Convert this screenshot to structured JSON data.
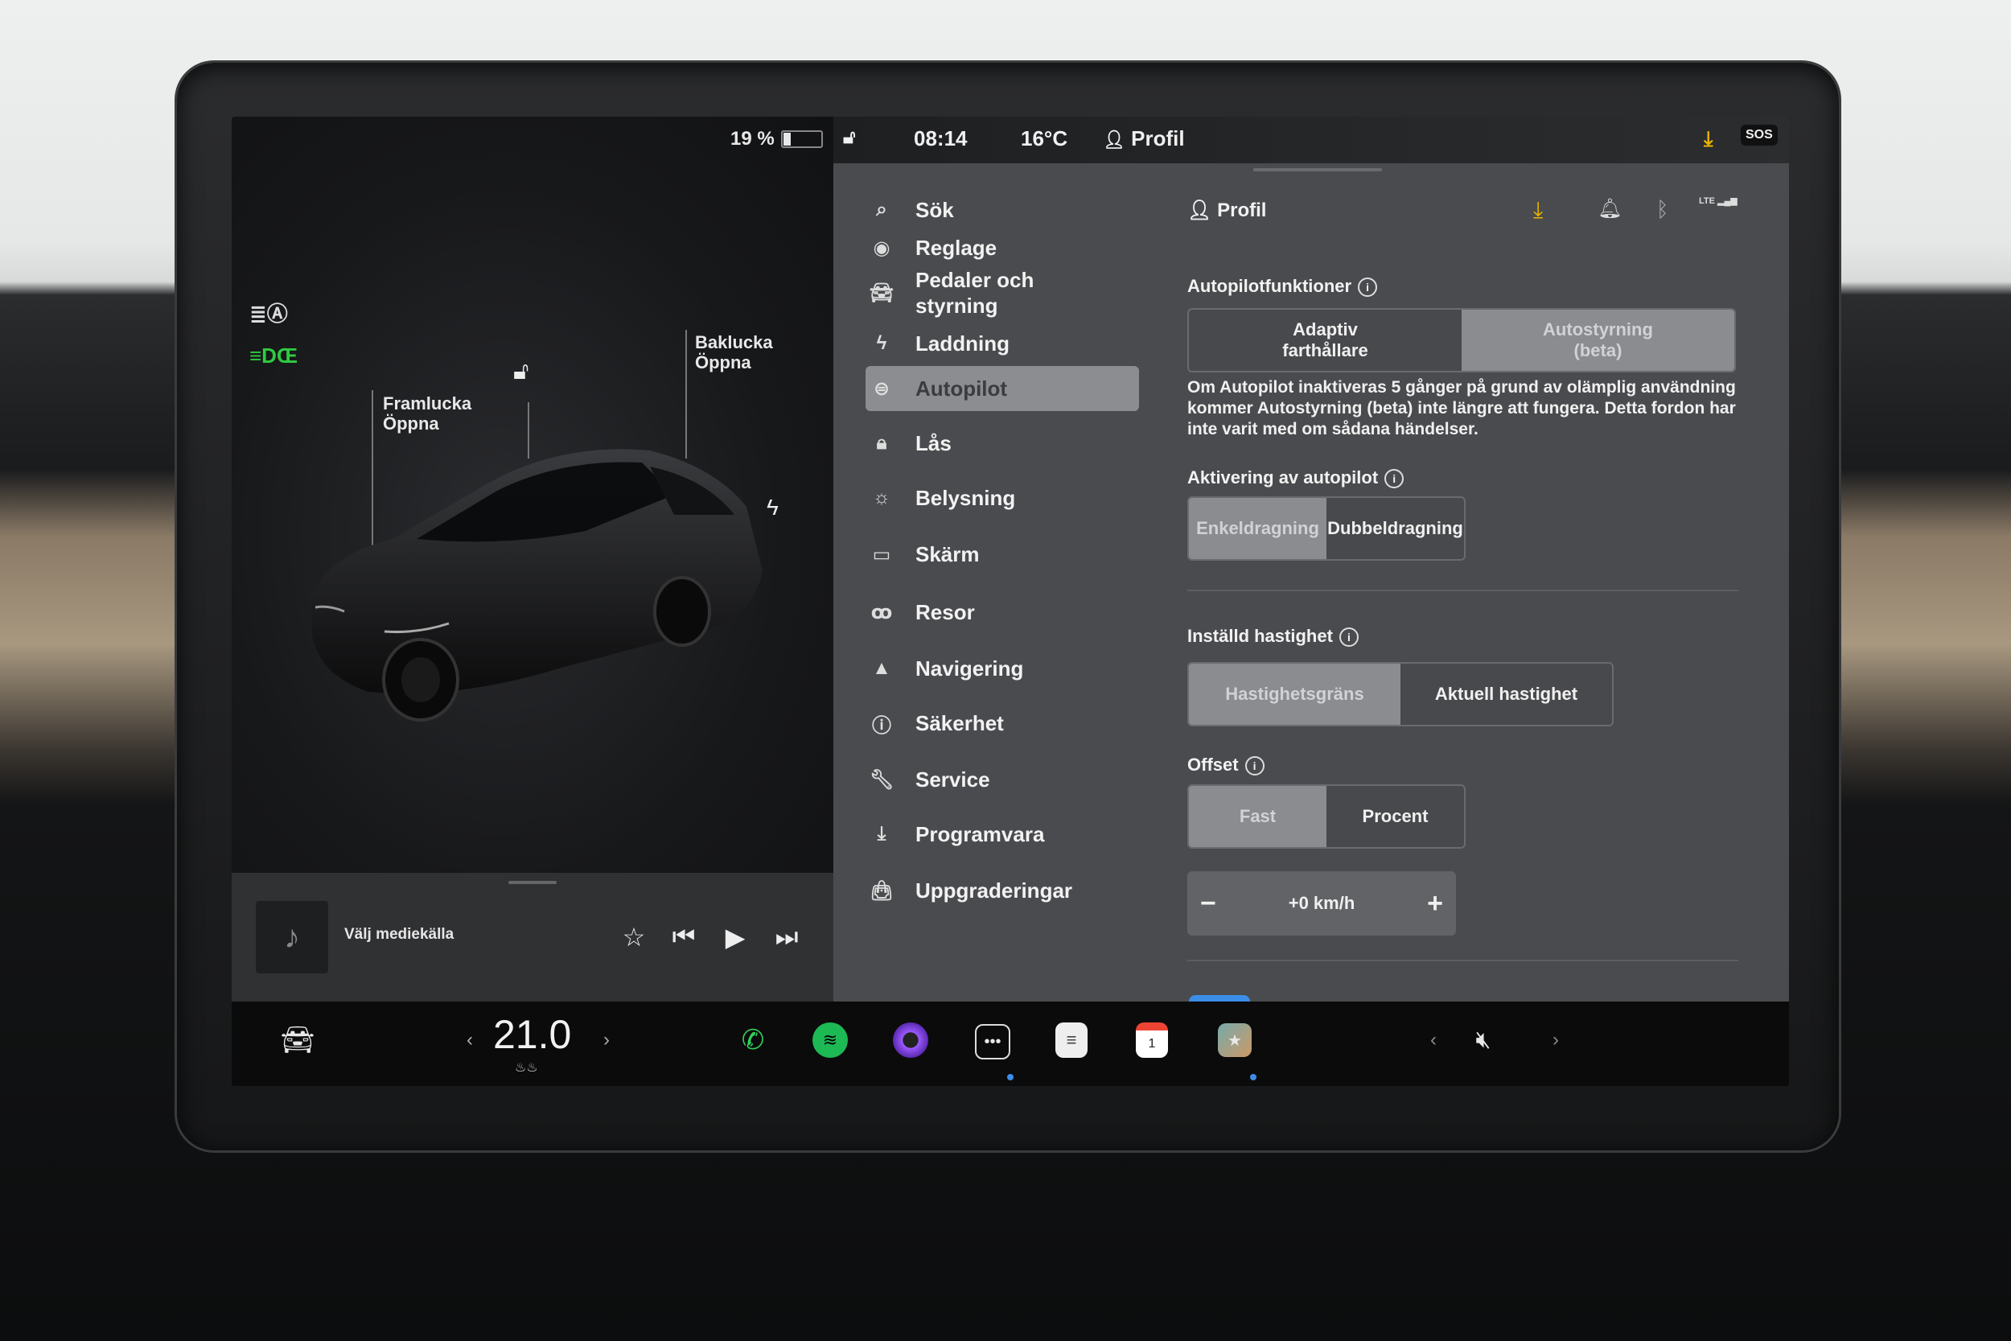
{
  "left_panel": {
    "battery_text": "19 %",
    "battery_level": 0.19,
    "headlight_icon": "auto-headlight-icon",
    "parking_light_icon": "parking-lights-icon",
    "front_trunk": {
      "title": "Framlucka",
      "action": "Öppna"
    },
    "rear_trunk": {
      "title": "Baklucka",
      "action": "Öppna"
    },
    "media": {
      "source_label": "Välj mediekälla"
    }
  },
  "topbar": {
    "time": "08:14",
    "temperature": "16°C",
    "profile": "Profil",
    "sos": "SOS"
  },
  "nav": {
    "items": [
      {
        "label": "Sök",
        "icon": "search-icon"
      },
      {
        "label": "Reglage",
        "icon": "toggle-icon"
      },
      {
        "label": "Pedaler och styrning",
        "icon": "car-icon"
      },
      {
        "label": "Laddning",
        "icon": "bolt-icon"
      },
      {
        "label": "Autopilot",
        "icon": "steering-wheel-icon"
      },
      {
        "label": "Lås",
        "icon": "lock-icon"
      },
      {
        "label": "Belysning",
        "icon": "sun-icon"
      },
      {
        "label": "Skärm",
        "icon": "display-icon"
      },
      {
        "label": "Resor",
        "icon": "trips-icon"
      },
      {
        "label": "Navigering",
        "icon": "navigation-icon"
      },
      {
        "label": "Säkerhet",
        "icon": "safety-icon"
      },
      {
        "label": "Service",
        "icon": "wrench-icon"
      },
      {
        "label": "Programvara",
        "icon": "download-icon"
      },
      {
        "label": "Uppgraderingar",
        "icon": "shopping-bag-icon"
      }
    ],
    "active": "Autopilot"
  },
  "content": {
    "profile": "Profil",
    "autopilot_features": {
      "heading": "Autopilotfunktioner",
      "options": [
        "Adaptiv farthållare",
        "Autostyrning (beta)"
      ],
      "selected": "Autostyrning (beta)",
      "note": "Om Autopilot inaktiveras 5 gånger på grund av olämplig användning kommer Autostyrning (beta) inte längre att fungera. Detta fordon har inte varit med om sådana händelser."
    },
    "activation": {
      "heading": "Aktivering av autopilot",
      "options": [
        "Enkeldragning",
        "Dubbeldragning"
      ],
      "selected": "Enkeldragning"
    },
    "set_speed": {
      "heading": "Inställd hastighet",
      "options": [
        "Hastighetsgräns",
        "Aktuell hastighet"
      ],
      "selected": "Hastighetsgräns"
    },
    "offset": {
      "heading": "Offset",
      "options": [
        "Fast",
        "Procent"
      ],
      "selected": "Fast",
      "value": "+0 km/h",
      "minus": "−",
      "plus": "+"
    }
  },
  "dock": {
    "temperature": "21.0",
    "lte": "LTE"
  },
  "colors": {
    "accent_yellow": "#e8b400",
    "spotify": "#1db954",
    "phone": "#2fd158",
    "active_dot": "#3b8ee8"
  }
}
